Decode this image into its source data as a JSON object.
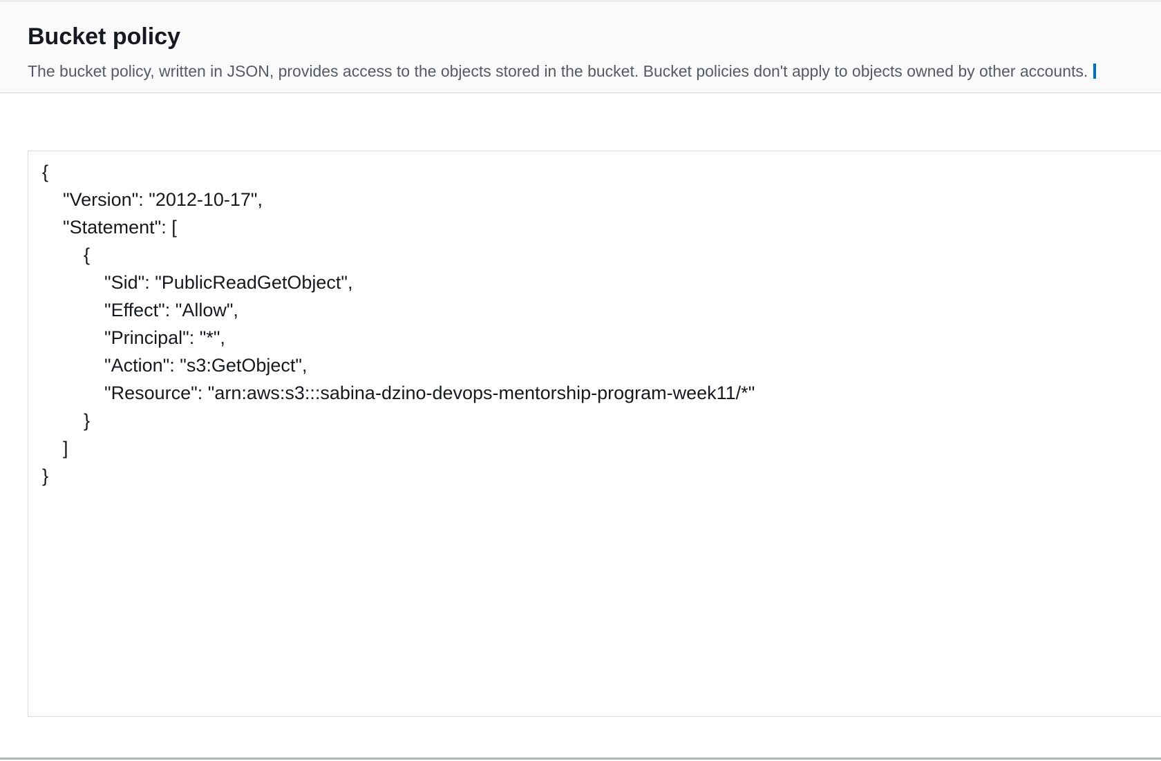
{
  "panel": {
    "title": "Bucket policy",
    "description": "The bucket policy, written in JSON, provides access to the objects stored in the bucket. Bucket policies don't apply to objects owned by other accounts."
  },
  "editor": {
    "lines": [
      "{",
      "    \"Version\": \"2012-10-17\",",
      "    \"Statement\": [",
      "        {",
      "            \"Sid\": \"PublicReadGetObject\",",
      "            \"Effect\": \"Allow\",",
      "            \"Principal\": \"*\",",
      "            \"Action\": \"s3:GetObject\",",
      "            \"Resource\": \"arn:aws:s3:::sabina-dzino-devops-mentorship-program-week11/*\"",
      "        }",
      "    ]",
      "}"
    ]
  }
}
